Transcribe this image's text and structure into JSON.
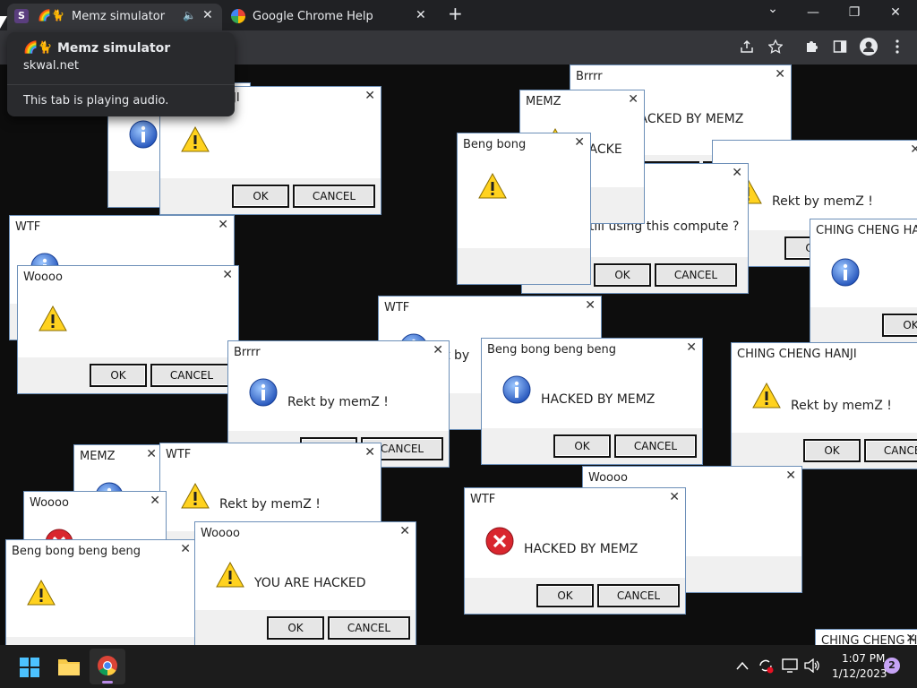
{
  "browser": {
    "tabs": [
      {
        "favicon_letter": "S",
        "emoji": "🌈🐈",
        "title": "Memz simulator",
        "audio": "🔈",
        "close": "✕"
      },
      {
        "title": "Google Chrome Help",
        "close": "✕"
      }
    ],
    "new_tab": "+",
    "window_controls": {
      "chevron": "⌄",
      "minimize": "—",
      "restore": "❐",
      "close": "✕"
    },
    "toolbar_icons": [
      "share-icon",
      "star-icon",
      "extensions-icon",
      "side-panel-icon",
      "profile-icon",
      "menu-icon"
    ],
    "hovercard": {
      "emoji": "🌈🐈",
      "title": "Memz simulator",
      "domain": "skwal.net",
      "status": "This tab is playing audio."
    }
  },
  "dialogs": [
    {
      "caption": "Brrrr",
      "icon": "info",
      "message": "HACKED BY MEMZ",
      "ok": "OK",
      "cancel": "CANCEL"
    },
    {
      "caption": "",
      "icon": "warning",
      "message": "Rekt by memZ !",
      "ok": "OK",
      "cancel": "CANCEL"
    },
    {
      "caption": "CHING CHENG HANJI",
      "icon": "info",
      "message": "",
      "ok": "OK",
      "cancel": "CANCEL"
    },
    {
      "caption": "Woooo",
      "icon": "warning",
      "message": "Still using this compute ?",
      "ok": "OK",
      "cancel": "CANCEL"
    },
    {
      "caption": "MEMZ",
      "icon": "warning",
      "message": "HACKE",
      "ok": "OK",
      "cancel": "CANCEL"
    },
    {
      "caption": "Beng bong",
      "icon": "warning",
      "message": "",
      "ok": "OK",
      "cancel": "CANCEL"
    },
    {
      "caption": "",
      "icon": "info",
      "message": "",
      "ok": "OK",
      "cancel": "CANCEL"
    },
    {
      "caption": "CHING HANJI",
      "icon": "warning",
      "message": "",
      "ok": "OK",
      "cancel": "CANCEL"
    },
    {
      "caption": "WTF",
      "icon": "info",
      "message": "",
      "ok": "OK",
      "cancel": "CANCEL"
    },
    {
      "caption": "Woooo",
      "icon": "warning",
      "message": "",
      "ok": "OK",
      "cancel": "CANCEL"
    },
    {
      "caption": "WTF",
      "icon": "info",
      "message": "kt by",
      "ok": "OK",
      "cancel": "CANCEL"
    },
    {
      "caption": "Brrrr",
      "icon": "info",
      "message": "Rekt by memZ !",
      "ok": "OK",
      "cancel": "CANCEL"
    },
    {
      "caption": "Beng bong beng beng",
      "icon": "info",
      "message": "HACKED BY MEMZ",
      "ok": "OK",
      "cancel": "CANCEL"
    },
    {
      "caption": "CHING CHENG HANJI",
      "icon": "warning",
      "message": "Rekt by memZ !",
      "ok": "OK",
      "cancel": "CANCEL"
    },
    {
      "caption": "MEMZ",
      "icon": "info",
      "message": "",
      "ok": "OK",
      "cancel": "CANCEL"
    },
    {
      "caption": "WTF",
      "icon": "warning",
      "message": "Rekt by memZ !",
      "ok": "OK",
      "cancel": "CANCEL"
    },
    {
      "caption": "Woooo",
      "icon": "error",
      "message": "",
      "ok": "OK",
      "cancel": "CANCEL"
    },
    {
      "caption": "Beng bong beng beng",
      "icon": "warning",
      "message": "",
      "ok": "OK",
      "cancel": "CANCEL"
    },
    {
      "caption": "Woooo",
      "icon": "warning",
      "message": "YOU ARE HACKED",
      "ok": "OK",
      "cancel": "CANCEL"
    },
    {
      "caption": "Woooo",
      "icon": "warning",
      "message": "",
      "ok": "OK",
      "cancel": "CANCEL"
    },
    {
      "caption": "WTF",
      "icon": "error",
      "message": "HACKED BY MEMZ",
      "ok": "OK",
      "cancel": "CANCEL"
    },
    {
      "caption": "CHING CHENG HA",
      "icon": "info",
      "message": "",
      "ok": "OK",
      "cancel": "CANCEL"
    }
  ],
  "fragments": [
    "YOU",
    "CHING",
    "MEMZ",
    "MEMZ",
    "Beng",
    "WT",
    "W",
    "Be",
    "is compu",
    "oooo",
    "Wo",
    "Bri",
    "ANJ",
    "CHING CHENG HANJI",
    "HACKE",
    "Beng bong beng beng"
  ],
  "taskbar": {
    "time": "1:07 PM",
    "date": "1/12/2023",
    "notification_count": "2"
  }
}
